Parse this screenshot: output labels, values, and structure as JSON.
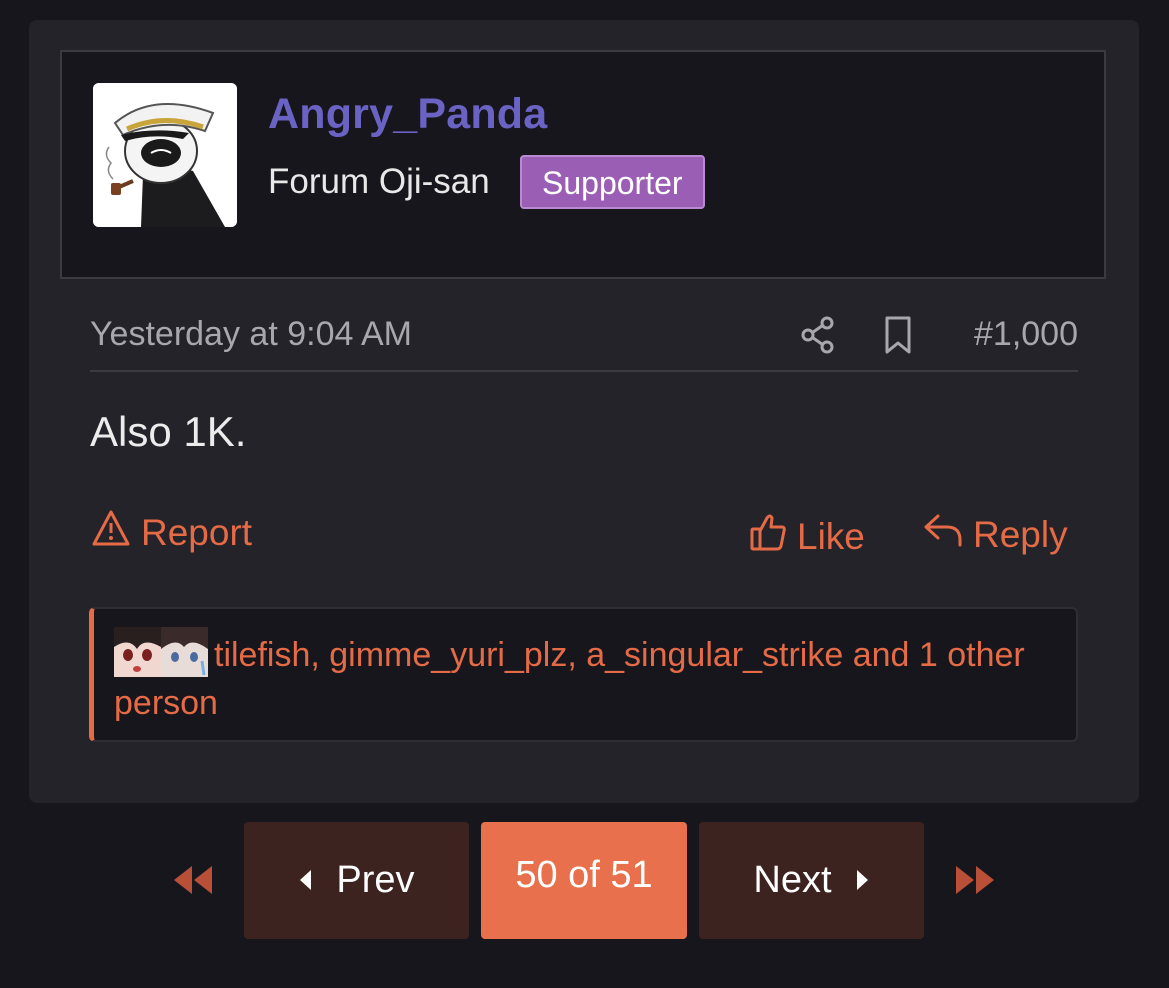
{
  "post": {
    "username": "Angry_Panda",
    "user_title": "Forum Oji-san",
    "badge": "Supporter",
    "timestamp": "Yesterday at 9:04 AM",
    "post_number": "#1,000",
    "message": "Also 1K.",
    "actions": {
      "report_label": "Report",
      "like_label": "Like",
      "reply_label": "Reply"
    },
    "reactions_text": "tilefish, gimme_yuri_plz, a_singular_strike and 1 other person"
  },
  "pagination": {
    "prev_label": "Prev",
    "current": "50 of 51",
    "next_label": "Next"
  },
  "colors": {
    "accent": "#e56b47",
    "username": "#6b63c4",
    "badge": "#9a5fb5"
  },
  "icons": [
    "share-icon",
    "bookmark-icon",
    "warning-icon",
    "thumbs-up-icon",
    "reply-icon",
    "double-left-icon",
    "caret-left-icon",
    "caret-right-icon",
    "double-right-icon"
  ]
}
